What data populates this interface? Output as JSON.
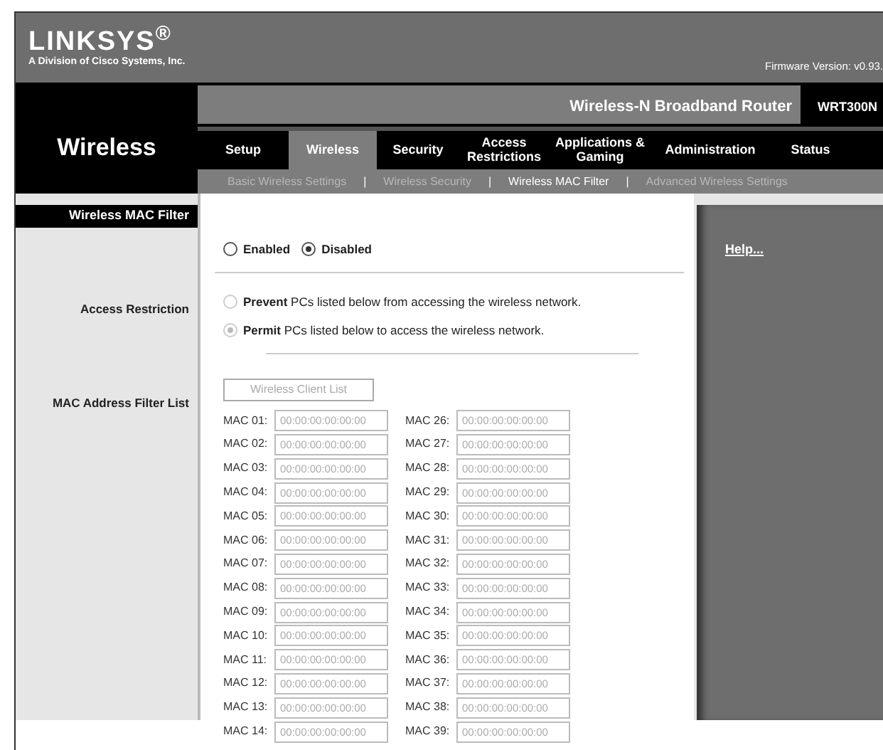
{
  "header": {
    "logo": "LINKSYS$^{®}$",
    "tagline": "A Division of Cisco Systems, Inc.",
    "firmware": "Firmware Version: v0.93."
  },
  "product": {
    "name": "Wireless-N Broadband Router",
    "model": "WRT300N"
  },
  "section": "Wireless",
  "tabs": [
    {
      "label": "Setup",
      "selected": false
    },
    {
      "label": "Wireless",
      "selected": true
    },
    {
      "label": "Security",
      "selected": false
    },
    {
      "label": "Access Restrictions",
      "selected": false
    },
    {
      "label": "Applications & Gaming",
      "selected": false
    },
    {
      "label": "Administration",
      "selected": false
    },
    {
      "label": "Status",
      "selected": false
    }
  ],
  "subtabs": [
    {
      "label": "Basic Wireless Settings",
      "selected": false
    },
    {
      "label": "Wireless Security",
      "selected": false
    },
    {
      "label": "Wireless MAC Filter",
      "selected": true
    },
    {
      "label": "Advanced Wireless Settings",
      "selected": false
    }
  ],
  "subtab_separator": "|",
  "panel_title": "Wireless MAC Filter",
  "filter_mode": [
    {
      "label": "Enabled",
      "selected": false
    },
    {
      "label": "Disabled",
      "selected": true
    }
  ],
  "access_restriction": {
    "label": "Access Restriction",
    "disabled": true,
    "options": [
      {
        "text": "**Prevent** PCs listed below from accessing the wireless network.",
        "selected": false
      },
      {
        "text": "**Permit** PCs listed below to access the wireless network.",
        "selected": true
      }
    ]
  },
  "mac_list": {
    "label": "MAC Address Filter List",
    "button": {
      "label": "Wireless Client List",
      "disabled": true
    },
    "entries": [
      {
        "left": {
          "label": "MAC 01:",
          "value": "00:00:00:00:00:00"
        },
        "right": {
          "label": "MAC 26:",
          "value": "00:00:00:00:00:00"
        }
      },
      {
        "left": {
          "label": "MAC 02:",
          "value": "00:00:00:00:00:00"
        },
        "right": {
          "label": "MAC 27:",
          "value": "00:00:00:00:00:00"
        }
      },
      {
        "left": {
          "label": "MAC 03:",
          "value": "00:00:00:00:00:00"
        },
        "right": {
          "label": "MAC 28:",
          "value": "00:00:00:00:00:00"
        }
      },
      {
        "left": {
          "label": "MAC 04:",
          "value": "00:00:00:00:00:00"
        },
        "right": {
          "label": "MAC 29:",
          "value": "00:00:00:00:00:00"
        }
      },
      {
        "left": {
          "label": "MAC 05:",
          "value": "00:00:00:00:00:00"
        },
        "right": {
          "label": "MAC 30:",
          "value": "00:00:00:00:00:00"
        }
      },
      {
        "left": {
          "label": "MAC 06:",
          "value": "00:00:00:00:00:00"
        },
        "right": {
          "label": "MAC 31:",
          "value": "00:00:00:00:00:00"
        }
      },
      {
        "left": {
          "label": "MAC 07:",
          "value": "00:00:00:00:00:00"
        },
        "right": {
          "label": "MAC 32:",
          "value": "00:00:00:00:00:00"
        }
      },
      {
        "left": {
          "label": "MAC 08:",
          "value": "00:00:00:00:00:00"
        },
        "right": {
          "label": "MAC 33:",
          "value": "00:00:00:00:00:00"
        }
      },
      {
        "left": {
          "label": "MAC 09:",
          "value": "00:00:00:00:00:00"
        },
        "right": {
          "label": "MAC 34:",
          "value": "00:00:00:00:00:00"
        }
      },
      {
        "left": {
          "label": "MAC 10:",
          "value": "00:00:00:00:00:00"
        },
        "right": {
          "label": "MAC 35:",
          "value": "00:00:00:00:00:00"
        }
      },
      {
        "left": {
          "label": "MAC 11:",
          "value": "00:00:00:00:00:00"
        },
        "right": {
          "label": "MAC 36:",
          "value": "00:00:00:00:00:00"
        }
      },
      {
        "left": {
          "label": "MAC 12:",
          "value": "00:00:00:00:00:00"
        },
        "right": {
          "label": "MAC 37:",
          "value": "00:00:00:00:00:00"
        }
      },
      {
        "left": {
          "label": "MAC 13:",
          "value": "00:00:00:00:00:00"
        },
        "right": {
          "label": "MAC 38:",
          "value": "00:00:00:00:00:00"
        }
      },
      {
        "left": {
          "label": "MAC 14:",
          "value": "00:00:00:00:00:00"
        },
        "right": {
          "label": "MAC 39:",
          "value": "00:00:00:00:00:00"
        }
      }
    ],
    "disabled": true
  },
  "help_link": "Help..."
}
